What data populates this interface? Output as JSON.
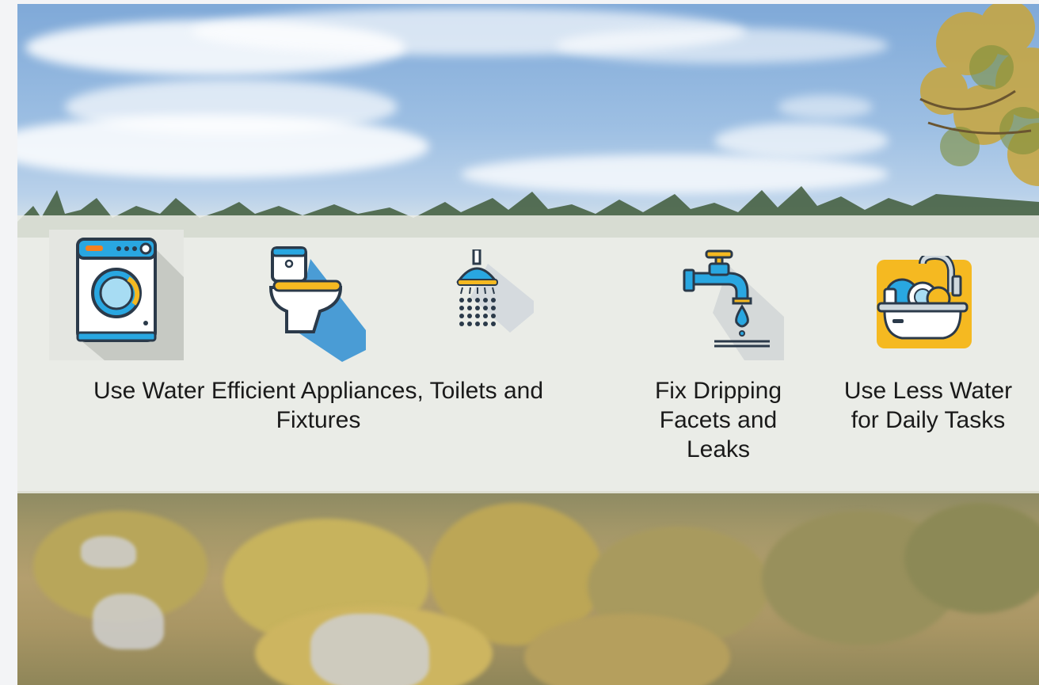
{
  "tips": [
    {
      "icon": "washing-machine-icon",
      "label": ""
    },
    {
      "icon": "toilet-icon",
      "label": ""
    },
    {
      "icon": "shower-head-icon",
      "label": ""
    },
    {
      "icon": "dripping-faucet-icon",
      "label": ""
    },
    {
      "icon": "dish-sink-icon",
      "label": ""
    }
  ],
  "captions": {
    "appliances_line1": "Use Water Efficient Appliances, Toilets and",
    "appliances_line2": "Fixtures",
    "leaks": "Fix Dripping Facets and Leaks",
    "daily": "Use Less Water for Daily Tasks"
  },
  "colors": {
    "band": "#ecede6",
    "icon_blue": "#29a7e1",
    "icon_yellow": "#f5b921",
    "outline": "#2b3a4a"
  }
}
